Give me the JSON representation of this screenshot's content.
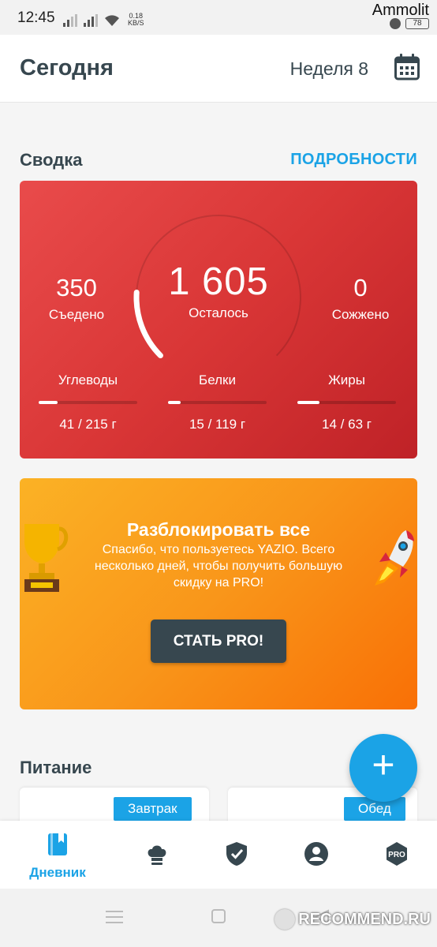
{
  "status_bar": {
    "time": "12:45",
    "net_speed_value": "0.18",
    "net_speed_unit": "KB/S",
    "battery": "78",
    "watermark": "Ammolit"
  },
  "header": {
    "title": "Сегодня",
    "week": "Неделя 8",
    "calendar_icon": "calendar-icon"
  },
  "summary": {
    "section_title": "Сводка",
    "details_link": "ПОДРОБНОСТИ",
    "eaten_value": "350",
    "eaten_label": "Съедено",
    "remaining_value": "1 605",
    "remaining_label": "Осталось",
    "burned_value": "0",
    "burned_label": "Сожжено",
    "progress_fraction": 0.18,
    "macros": [
      {
        "label": "Углеводы",
        "value_text": "41 / 215 г",
        "consumed": 41,
        "goal": 215
      },
      {
        "label": "Белки",
        "value_text": "15 / 119 г",
        "consumed": 15,
        "goal": 119
      },
      {
        "label": "Жиры",
        "value_text": "14 / 63 г",
        "consumed": 14,
        "goal": 63
      }
    ],
    "card_color": "#d93636"
  },
  "promo": {
    "title": "Разблокировать все",
    "description": "Спасибо, что пользуетесь YAZIO. Всего несколько дней, чтобы получить большую скидку на PRO!",
    "button_label": "СТАТЬ PRO!",
    "left_icon": "trophy-icon",
    "right_icon": "rocket-icon"
  },
  "nutrition": {
    "section_title": "Питание",
    "meals": [
      {
        "label": "Завтрак"
      },
      {
        "label": "Обед"
      }
    ]
  },
  "fab": {
    "label": "+"
  },
  "bottom_nav": {
    "items": [
      {
        "label": "Дневник",
        "icon": "diary-icon",
        "active": true
      },
      {
        "label": "",
        "icon": "chef-hat-icon",
        "active": false
      },
      {
        "label": "",
        "icon": "shield-check-icon",
        "active": false
      },
      {
        "label": "",
        "icon": "profile-icon",
        "active": false
      },
      {
        "label": "",
        "icon": "pro-badge-icon",
        "active": false
      }
    ],
    "pro_badge_text": "PRO"
  },
  "overlay": {
    "recommend_watermark": "RECOMMEND.RU"
  },
  "colors": {
    "accent": "#1ba3e6",
    "text_dark": "#37474f",
    "promo_orange": "#f9961a"
  }
}
